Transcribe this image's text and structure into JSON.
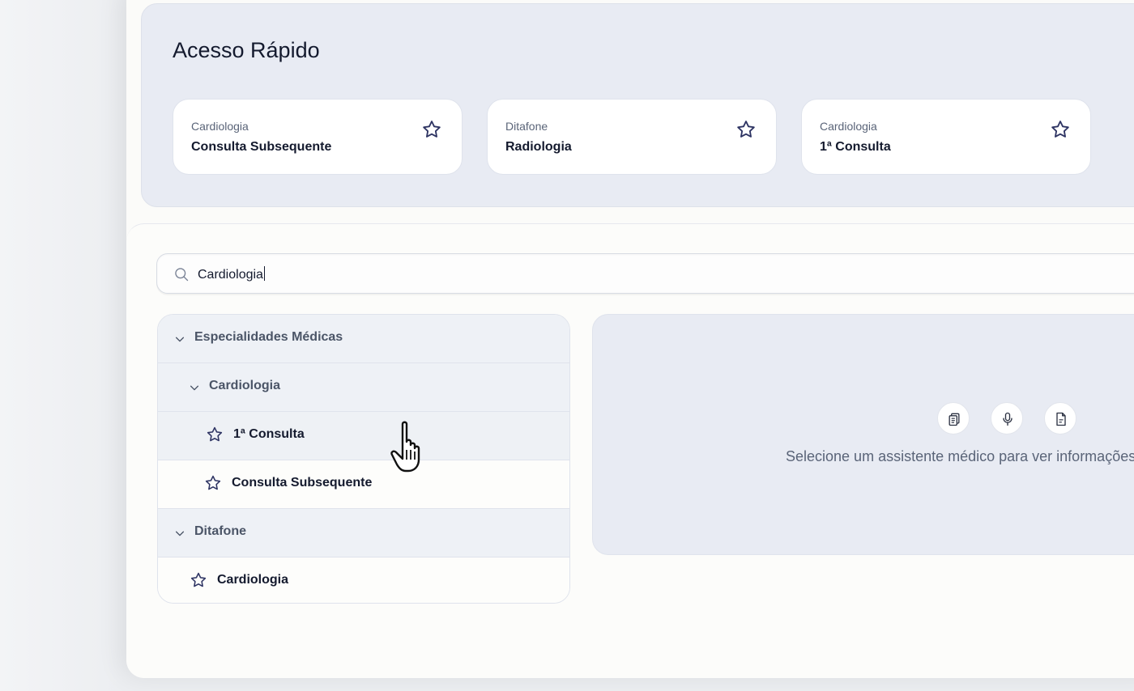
{
  "quick_access": {
    "title": "Acesso Rápido",
    "cards": [
      {
        "category": "Cardiologia",
        "name": "Consulta Subsequente",
        "icon": "star-outline-icon"
      },
      {
        "category": "Ditafone",
        "name": "Radiologia",
        "icon": "star-outline-icon"
      },
      {
        "category": "Cardiologia",
        "name": "1ª Consulta",
        "icon": "star-outline-icon"
      }
    ]
  },
  "search": {
    "value": "Cardiologia",
    "icon": "search-icon"
  },
  "tree": {
    "groups": [
      {
        "label": "Especialidades Médicas",
        "expanded": true,
        "children": [
          {
            "label": "Cardiologia",
            "expanded": true,
            "items": [
              {
                "label": "1ª Consulta",
                "hovered": true
              },
              {
                "label": "Consulta Subsequente"
              }
            ]
          }
        ]
      },
      {
        "label": "Ditafone",
        "expanded": true,
        "items": [
          {
            "label": "Cardiologia"
          }
        ]
      }
    ]
  },
  "detail": {
    "message": "Selecione um assistente médico para ver informações",
    "icons": [
      "clipboard-copy-icon",
      "microphone-icon",
      "document-icon"
    ]
  },
  "colors": {
    "accent": "#2e3463",
    "panel": "#e8ebf3",
    "text_muted": "#5a6478"
  }
}
